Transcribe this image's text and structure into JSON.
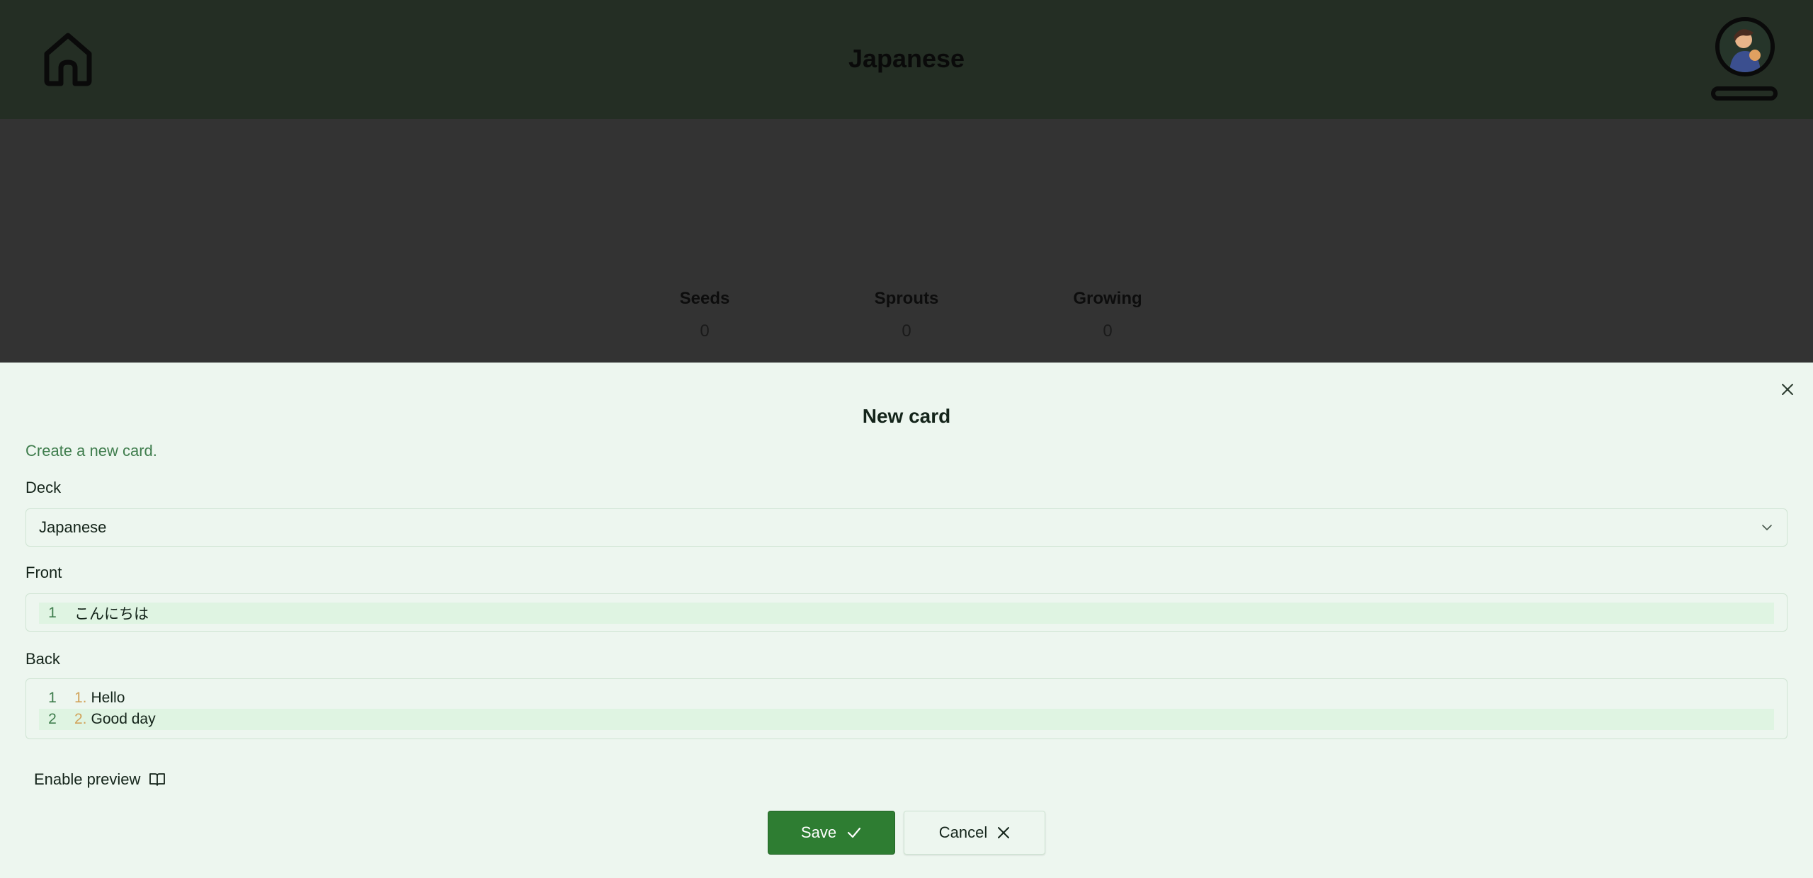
{
  "header": {
    "title": "Japanese",
    "home_icon": "home-icon",
    "avatar_icon": "avatar-icon"
  },
  "stats": [
    {
      "label": "Seeds",
      "value": "0"
    },
    {
      "label": "Sprouts",
      "value": "0"
    },
    {
      "label": "Growing",
      "value": "0"
    }
  ],
  "dialog": {
    "title": "New card",
    "description": "Create a new card.",
    "close_icon": "close-icon",
    "deck": {
      "label": "Deck",
      "value": "Japanese"
    },
    "front": {
      "label": "Front",
      "lines": [
        {
          "num": "1",
          "text": "こんにちは"
        }
      ]
    },
    "back": {
      "label": "Back",
      "lines": [
        {
          "num": "1",
          "marker": "1.",
          "text": "Hello"
        },
        {
          "num": "2",
          "marker": "2.",
          "text": "Good day"
        }
      ]
    },
    "preview_label": "Enable preview",
    "preview_icon": "book-open-icon",
    "save_label": "Save",
    "save_icon": "check-icon",
    "cancel_label": "Cancel",
    "cancel_icon": "close-icon"
  },
  "colors": {
    "header_bg": "#242e24",
    "backdrop": "#333333",
    "dialog_bg": "#edf6ef",
    "accent": "#2e7d32",
    "muted_green": "#3f7d4d",
    "active_line": "#dff4e2",
    "list_marker": "#d1a35a"
  }
}
